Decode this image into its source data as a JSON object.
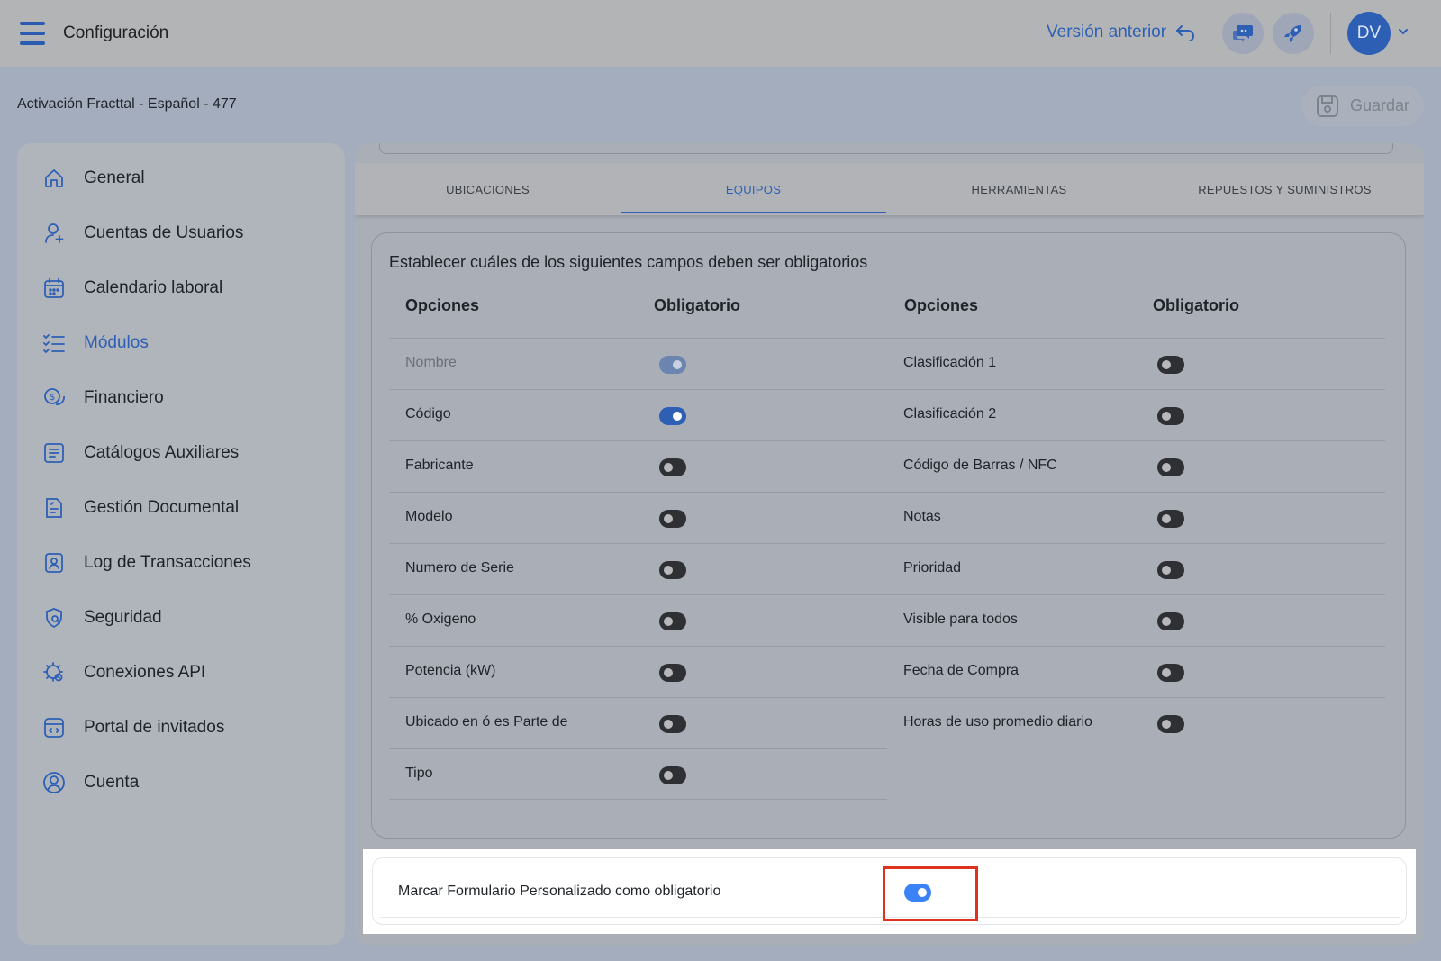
{
  "header": {
    "app_title": "Configuración",
    "prev_version_label": "Versión anterior",
    "avatar_initials": "DV",
    "accent_color": "#2d5fb5"
  },
  "breadcrumb": "Activación Fracttal - Español - 477",
  "toolbar": {
    "save_label": "Guardar"
  },
  "sidebar": {
    "items": [
      {
        "label": "General",
        "icon": "home-icon",
        "active": false
      },
      {
        "label": "Cuentas de Usuarios",
        "icon": "user-add-icon",
        "active": false
      },
      {
        "label": "Calendario laboral",
        "icon": "calendar-icon",
        "active": false
      },
      {
        "label": "Módulos",
        "icon": "checklist-icon",
        "active": true
      },
      {
        "label": "Financiero",
        "icon": "coins-icon",
        "active": false
      },
      {
        "label": "Catálogos Auxiliares",
        "icon": "catalog-icon",
        "active": false
      },
      {
        "label": "Gestión Documental",
        "icon": "document-icon",
        "active": false
      },
      {
        "label": "Log de Transacciones",
        "icon": "log-icon",
        "active": false
      },
      {
        "label": "Seguridad",
        "icon": "shield-icon",
        "active": false
      },
      {
        "label": "Conexiones API",
        "icon": "api-gear-icon",
        "active": false
      },
      {
        "label": "Portal de invitados",
        "icon": "portal-icon",
        "active": false
      },
      {
        "label": "Cuenta",
        "icon": "account-circle-icon",
        "active": false
      }
    ]
  },
  "tabs": [
    {
      "label": "UBICACIONES",
      "active": false
    },
    {
      "label": "EQUIPOS",
      "active": true
    },
    {
      "label": "HERRAMIENTAS",
      "active": false
    },
    {
      "label": "REPUESTOS Y SUMINISTROS",
      "active": false
    }
  ],
  "fields_card": {
    "title": "Establecer cuáles de los siguientes campos deben ser obligatorios",
    "col_options": "Opciones",
    "col_required": "Obligatorio",
    "left_rows": [
      {
        "label": "Nombre",
        "on": true,
        "disabled": true
      },
      {
        "label": "Código",
        "on": true,
        "disabled": false
      },
      {
        "label": "Fabricante",
        "on": false,
        "disabled": false
      },
      {
        "label": "Modelo",
        "on": false,
        "disabled": false
      },
      {
        "label": "Numero de Serie",
        "on": false,
        "disabled": false
      },
      {
        "label": "% Oxigeno",
        "on": false,
        "disabled": false
      },
      {
        "label": "Potencia (kW)",
        "on": false,
        "disabled": false
      },
      {
        "label": "Ubicado en ó es Parte de",
        "on": false,
        "disabled": false
      },
      {
        "label": "Tipo",
        "on": false,
        "disabled": false
      }
    ],
    "right_rows": [
      {
        "label": "Clasificación 1",
        "on": false,
        "disabled": false
      },
      {
        "label": "Clasificación 2",
        "on": false,
        "disabled": false
      },
      {
        "label": "Código de Barras / NFC",
        "on": false,
        "disabled": false
      },
      {
        "label": "Notas",
        "on": false,
        "disabled": false
      },
      {
        "label": "Prioridad",
        "on": false,
        "disabled": false
      },
      {
        "label": "Visible para todos",
        "on": false,
        "disabled": false
      },
      {
        "label": "Fecha de Compra",
        "on": false,
        "disabled": false
      },
      {
        "label": "Horas de uso promedio diario",
        "on": false,
        "disabled": false
      }
    ]
  },
  "custom_form": {
    "label": "Marcar Formulario Personalizado como obligatorio",
    "on": true
  }
}
